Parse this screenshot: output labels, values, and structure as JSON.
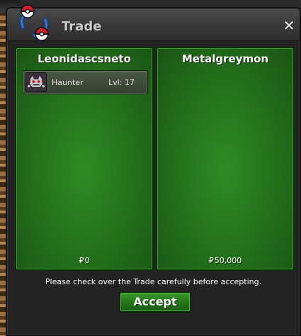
{
  "window": {
    "title": "Trade",
    "close_label": "✕"
  },
  "left_panel": {
    "player_name": "Leonidascsneto",
    "pokemon": [
      {
        "name": "Haunter",
        "level": "Lvl: 17"
      }
    ],
    "currency_symbol": "₽",
    "money": "0"
  },
  "right_panel": {
    "player_name": "Metalgreymon",
    "currency_symbol": "₽",
    "money": "50,000"
  },
  "footer": {
    "notice": "Please check over the Trade carefully before accepting.",
    "accept_label": "Accept"
  },
  "colors": {
    "panel_green": "#236e1b",
    "window_dark": "#232323",
    "accept_green": "#237418"
  }
}
